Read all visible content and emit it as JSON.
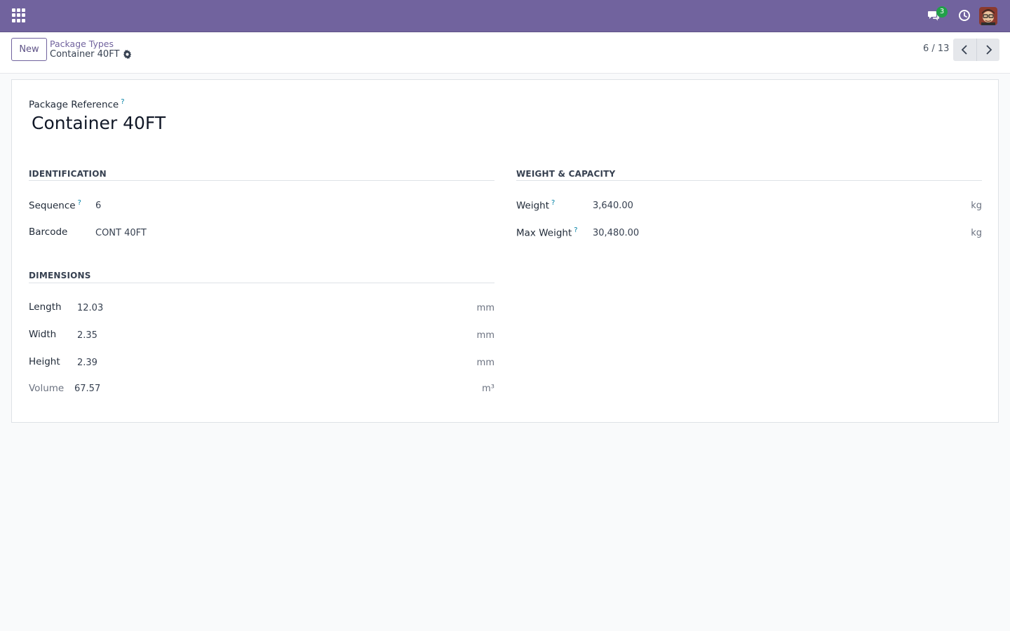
{
  "navbar": {
    "messages_badge": "3",
    "accent_color": "#71639e"
  },
  "control_panel": {
    "new_label": "New",
    "breadcrumb_parent": "Package Types",
    "breadcrumb_current": "Container 40FT",
    "pager": "6 / 13"
  },
  "form": {
    "reference_label": "Package Reference",
    "help_mark": "?",
    "reference_value": "Container 40FT",
    "identification": {
      "title": "IDENTIFICATION",
      "sequence_label": "Sequence",
      "sequence_value": "6",
      "barcode_label": "Barcode",
      "barcode_value": "CONT 40FT"
    },
    "dimensions": {
      "title": "DIMENSIONS",
      "length_label": "Length",
      "length_value": "12.03",
      "length_unit": "mm",
      "width_label": "Width",
      "width_value": "2.35",
      "width_unit": "mm",
      "height_label": "Height",
      "height_value": "2.39",
      "height_unit": "mm",
      "volume_label": "Volume",
      "volume_value": "67.57",
      "volume_unit": "m³"
    },
    "weight_capacity": {
      "title": "WEIGHT & CAPACITY",
      "weight_label": "Weight",
      "weight_value": "3,640.00",
      "weight_unit": "kg",
      "max_weight_label": "Max Weight",
      "max_weight_value": "30,480.00",
      "max_weight_unit": "kg"
    }
  }
}
